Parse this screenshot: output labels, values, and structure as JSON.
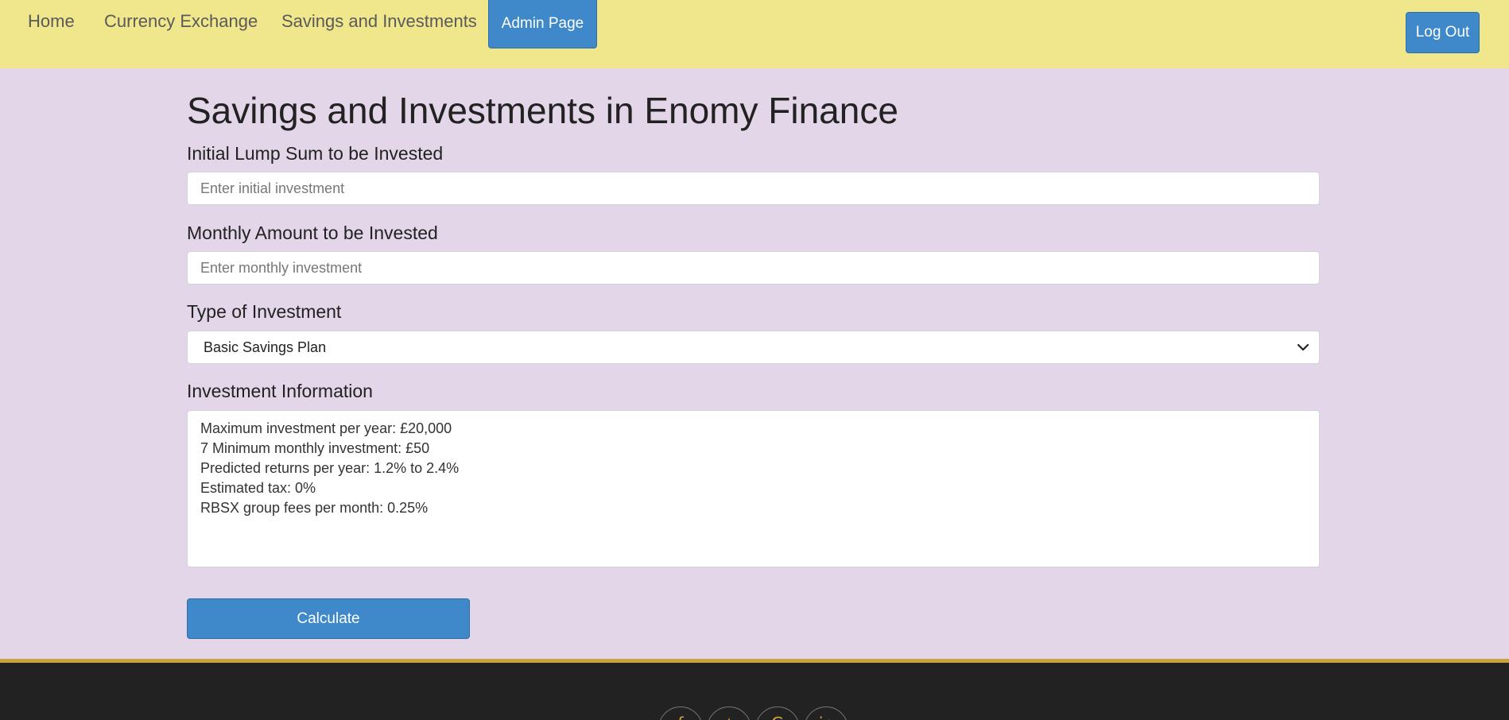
{
  "nav": {
    "home": "Home",
    "currency_exchange": "Currency Exchange",
    "savings_investments": "Savings and Investments",
    "admin_page": "Admin Page",
    "log_out": "Log Out"
  },
  "main": {
    "title": "Savings and Investments in Enomy Finance",
    "lump_sum_label": "Initial Lump Sum to be Invested",
    "lump_sum_placeholder": "Enter initial investment",
    "monthly_label": "Monthly Amount to be Invested",
    "monthly_placeholder": "Enter monthly investment",
    "type_label": "Type of Investment",
    "type_selected": "Basic Savings Plan",
    "info_label": "Investment Information",
    "info_lines": [
      "Maximum investment per year: £20,000",
      "7 Minimum monthly investment: £50",
      "Predicted returns per year: 1.2% to 2.4%",
      "Estimated tax: 0%",
      "RBSX group fees per month: 0.25%"
    ],
    "calculate": "Calculate"
  },
  "footer": {
    "social_icons": [
      "facebook-icon",
      "twitter-icon",
      "google-icon",
      "linkedin-icon"
    ],
    "accent_color": "#c9a23a"
  },
  "colors": {
    "navbar": "#f0e68c",
    "background": "#e2d6e8",
    "primary": "#3f88c9",
    "footer": "#222222"
  }
}
